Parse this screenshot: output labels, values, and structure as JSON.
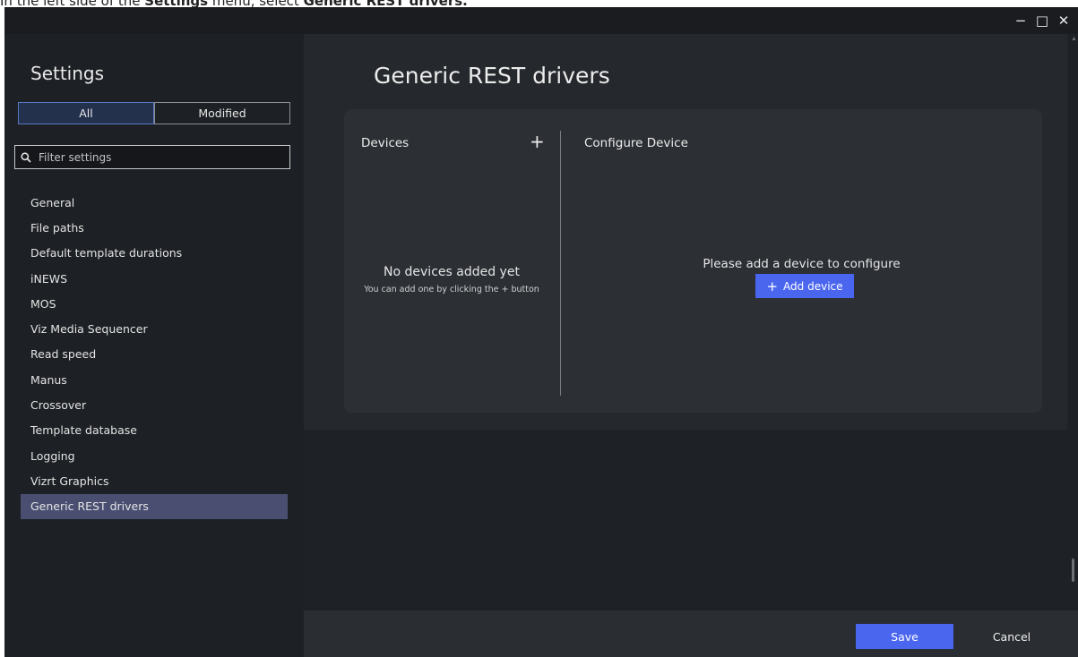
{
  "instruction": {
    "prefix": "In the left side of the ",
    "menu": "Settings",
    "middle": " menu, select ",
    "target": "Generic REST drivers."
  },
  "window_controls": {
    "minimize": "−",
    "maximize": "□",
    "close": "✕"
  },
  "sidebar": {
    "title": "Settings",
    "filter_tabs": [
      {
        "label": "All",
        "active": true
      },
      {
        "label": "Modified",
        "active": false
      }
    ],
    "filter_placeholder": "Filter settings",
    "items": [
      {
        "label": "General"
      },
      {
        "label": "File paths"
      },
      {
        "label": "Default template durations"
      },
      {
        "label": "iNEWS"
      },
      {
        "label": "MOS"
      },
      {
        "label": "Viz Media Sequencer"
      },
      {
        "label": "Read speed"
      },
      {
        "label": "Manus"
      },
      {
        "label": "Crossover"
      },
      {
        "label": "Template database"
      },
      {
        "label": "Logging"
      },
      {
        "label": "Vizrt Graphics"
      },
      {
        "label": "Generic REST drivers",
        "selected": true
      }
    ]
  },
  "main": {
    "title": "Generic REST drivers",
    "devices": {
      "header": "Devices",
      "add_icon": "+",
      "empty_title": "No devices added yet",
      "empty_subtitle": "You can add one by clicking the + button"
    },
    "configure": {
      "header": "Configure Device",
      "message": "Please add a device to configure",
      "add_button_icon": "+",
      "add_button_label": "Add device"
    }
  },
  "footer": {
    "save_label": "Save",
    "cancel_label": "Cancel"
  },
  "colors": {
    "accent": "#4a66ef",
    "selected_item": "#4a4f72",
    "background": "#1e2125"
  }
}
